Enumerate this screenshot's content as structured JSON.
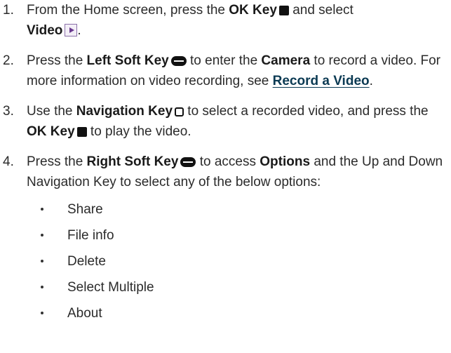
{
  "steps": [
    {
      "number": "1.",
      "t1": "From the Home screen, press the ",
      "b1": "OK Key",
      "t2": " and select ",
      "b2": "Video",
      "t3": "."
    },
    {
      "number": "2.",
      "t1": "Press the ",
      "b1": "Left Soft Key",
      "t2": " to enter the ",
      "b2": "Camera",
      "t3": " to record a video. For more information on video recording, see ",
      "link": "Record a Video",
      "t4": "."
    },
    {
      "number": "3.",
      "t1": "Use the ",
      "b1": "Navigation Key",
      "t2": " to select a recorded video, and press the ",
      "b2": "OK Key",
      "t3": " to play the video."
    },
    {
      "number": "4.",
      "t1": "Press the ",
      "b1": "Right Soft Key",
      "t2": " to access ",
      "b2": "Options",
      "t3": " and the Up and Down Navigation Key to select any of the below options:"
    }
  ],
  "options": [
    "Share",
    "File info",
    "Delete",
    "Select Multiple",
    "About"
  ],
  "icons": {
    "ok_key": "ok-key-square-icon",
    "soft_key": "soft-key-icon",
    "navigation_key": "navigation-key-icon",
    "video_app": "video-app-icon"
  }
}
